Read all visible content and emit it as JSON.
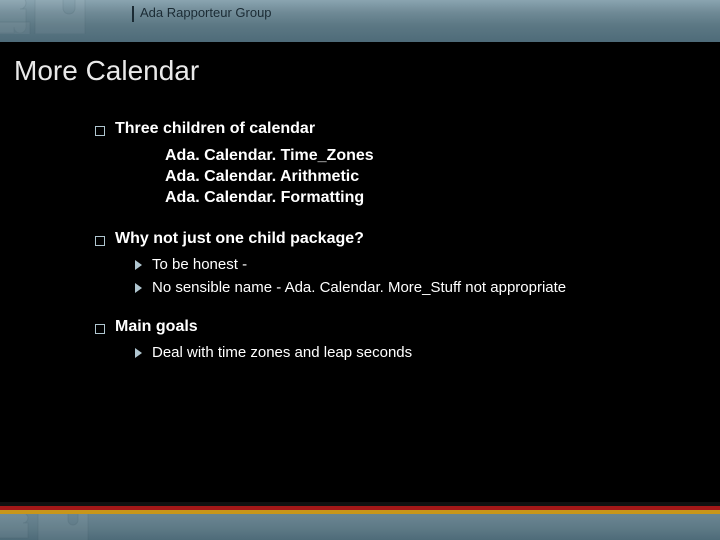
{
  "header": {
    "org": "Ada Rapporteur Group"
  },
  "title": "More Calendar",
  "bullets": [
    {
      "label": "Three children of calendar",
      "sublines": [
        "Ada. Calendar. Time_Zones",
        "Ada. Calendar. Arithmetic",
        "Ada. Calendar. Formatting"
      ],
      "children": []
    },
    {
      "label": "Why not just one child package?",
      "sublines": [],
      "children": [
        "To be honest -",
        "No sensible name - Ada. Calendar. More_Stuff not appropriate"
      ]
    },
    {
      "label": "Main goals",
      "sublines": [],
      "children": [
        "Deal with time zones and leap seconds"
      ]
    }
  ]
}
